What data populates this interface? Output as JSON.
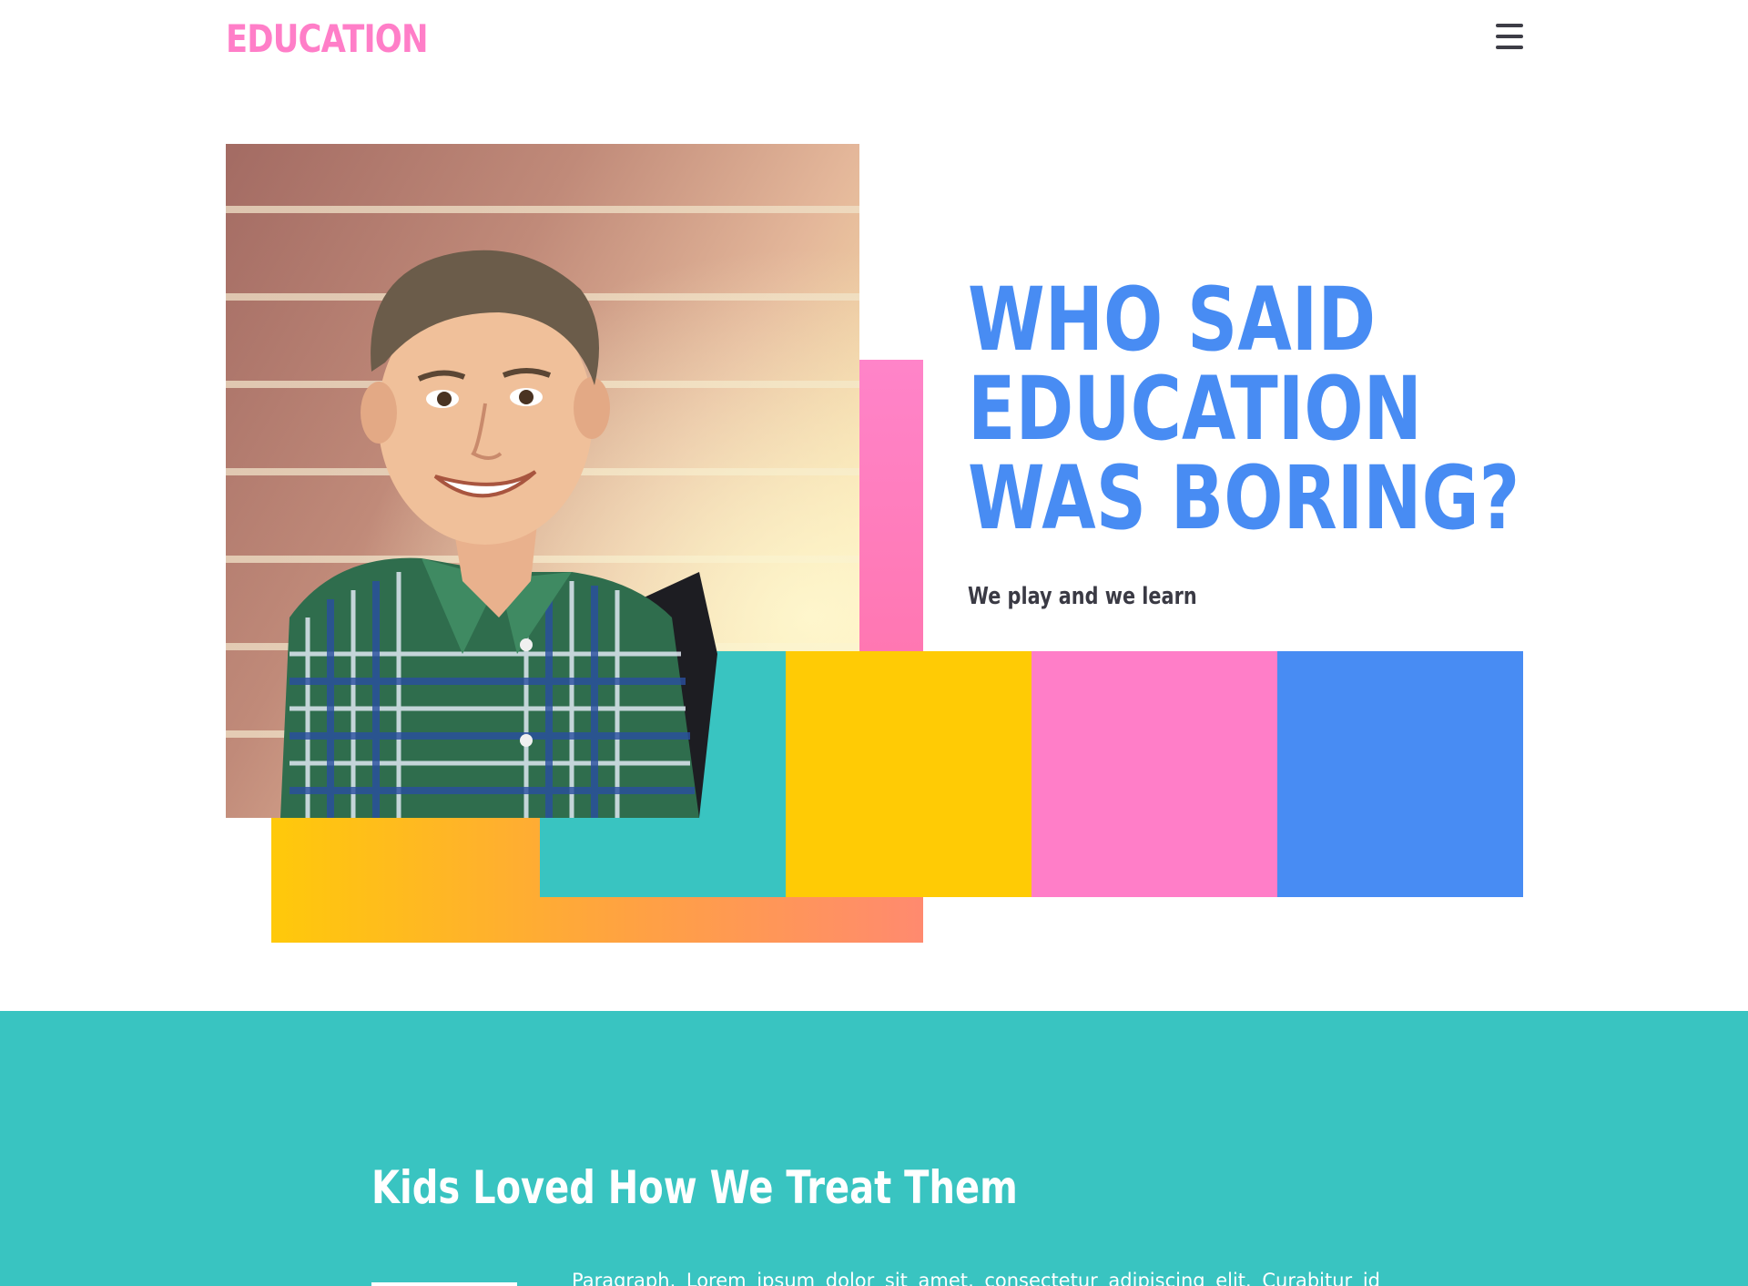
{
  "header": {
    "logo": "EDUCATION",
    "menu_icon": "hamburger-menu-icon"
  },
  "hero": {
    "title_lines": [
      "WHO SAID",
      "EDUCATION",
      "WAS BORING?"
    ],
    "subtitle": "We play and we learn",
    "image": "smiling-boy-photo",
    "colors": {
      "teal": "#39c4c1",
      "yellow": "#ffcb05",
      "pink": "#ff7ec8",
      "blue": "#488cf3",
      "orange": "#ffa242"
    }
  },
  "section": {
    "title": "Kids Loved How We Treat Them",
    "paragraph": "Paragraph. Lorem ipsum dolor sit amet, consectetur adipiscing elit. Curabitur id"
  }
}
